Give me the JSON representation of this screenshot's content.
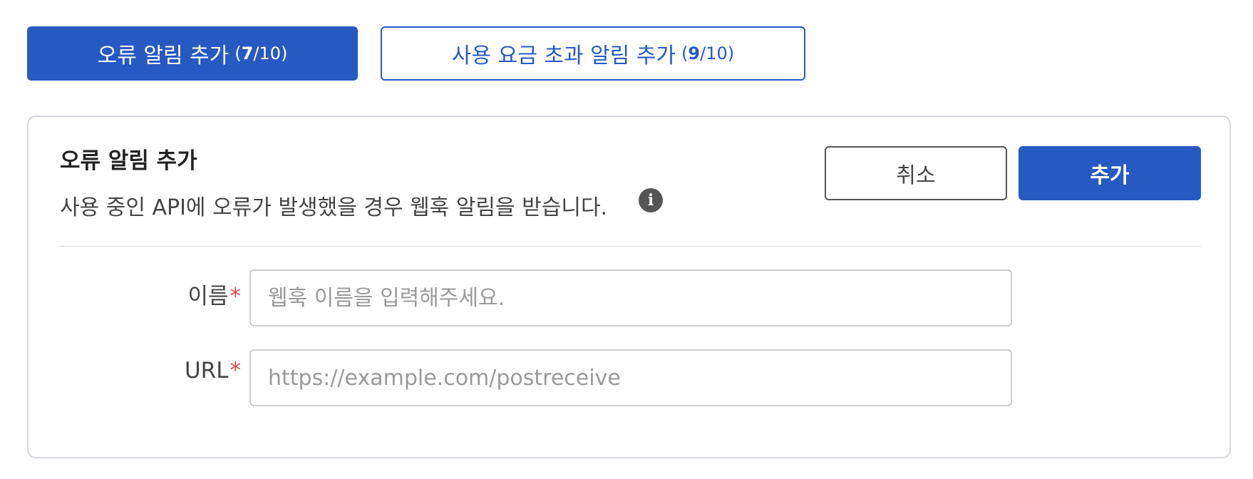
{
  "tabs": {
    "error": {
      "label": "오류 알림 추가",
      "count_current": "7",
      "count_rest": "/10)",
      "count_open": "("
    },
    "usage": {
      "label": "사용 요금 초과 알림 추가",
      "count_current": "9",
      "count_rest": "/10)",
      "count_open": "("
    }
  },
  "panel": {
    "title": "오류 알림 추가",
    "description": "사용 중인 API에 오류가 발생했을 경우 웹훅 알림을 받습니다.",
    "info_icon": "info-icon",
    "cancel_label": "취소",
    "add_label": "추가"
  },
  "form": {
    "name": {
      "label": "이름",
      "required": "*",
      "value": "",
      "placeholder": "웹훅 이름을 입력해주세요."
    },
    "url": {
      "label": "URL",
      "required": "*",
      "value": "",
      "placeholder": "https://example.com/postreceive"
    }
  },
  "colors": {
    "accent": "#2759c3",
    "required": "#e04a4a",
    "border": "#d5d7de"
  }
}
